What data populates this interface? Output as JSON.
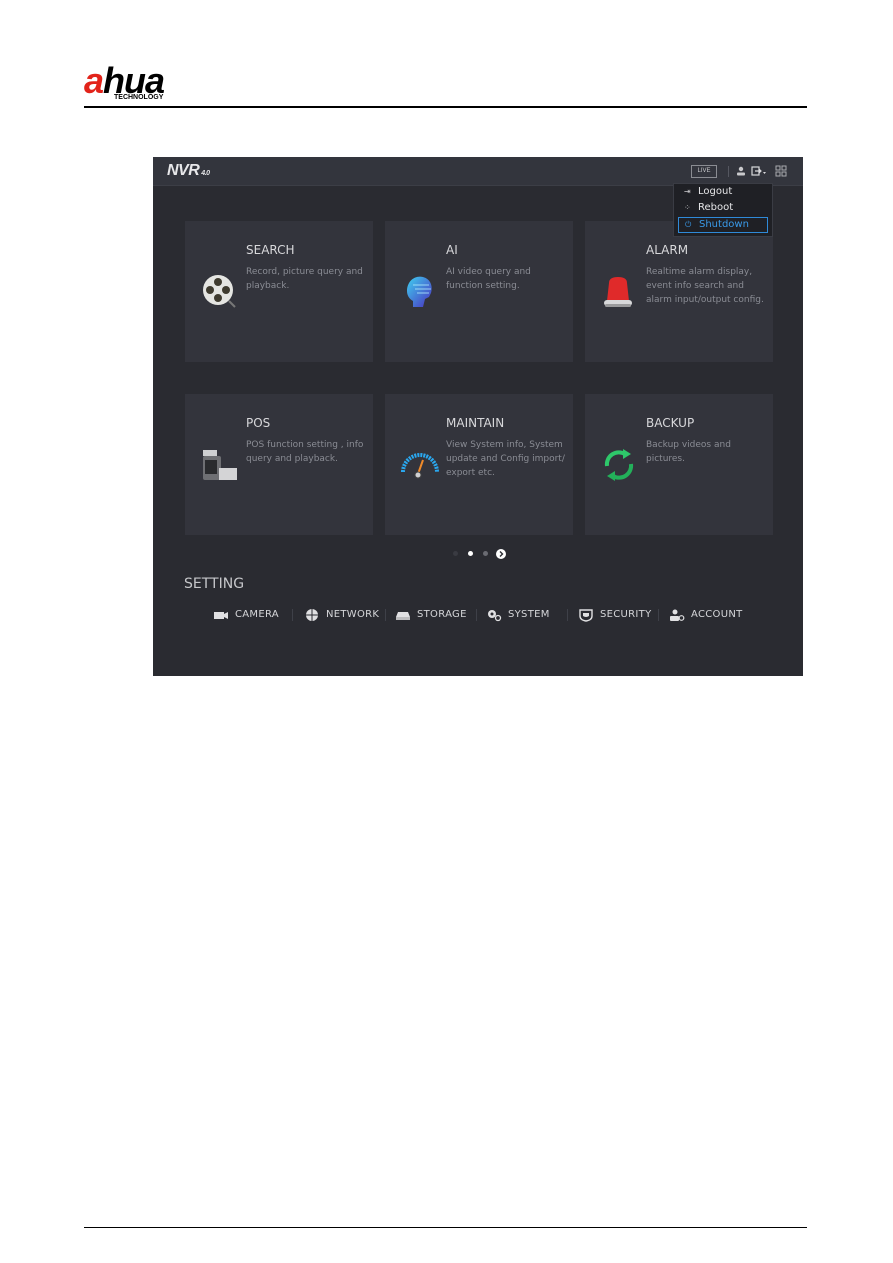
{
  "document": {
    "brand": {
      "name_red": "a",
      "name_black": "hua",
      "tagline": "TECHNOLOGY"
    }
  },
  "app": {
    "title": "NVR",
    "version": "4.0",
    "live_label": "LIVE",
    "icons": {
      "user": "user-icon",
      "logout_menu": "logout-menu-icon",
      "grid": "grid-icon"
    }
  },
  "power_menu": {
    "items": [
      {
        "label": "Logout",
        "icon": "logout-icon",
        "glyph": "⇥",
        "active": false
      },
      {
        "label": "Reboot",
        "icon": "reboot-icon",
        "glyph": "⁘",
        "active": false
      },
      {
        "label": "Shutdown",
        "icon": "power-icon",
        "glyph": "⏻",
        "active": true
      }
    ]
  },
  "modules": [
    {
      "title": "SEARCH",
      "desc": "Record, picture query and playback.",
      "icon": "film-reel-icon"
    },
    {
      "title": "AI",
      "desc": "AI video query and function setting.",
      "icon": "ai-head-icon"
    },
    {
      "title": "ALARM",
      "desc": "Realtime alarm display, event info search and alarm input/output config.",
      "icon": "alarm-light-icon"
    },
    {
      "title": "POS",
      "desc": "POS function setting , info query and playback.",
      "icon": "pos-terminal-icon"
    },
    {
      "title": "MAINTAIN",
      "desc": "View System info, System update and Config import/ export etc.",
      "icon": "gauge-icon"
    },
    {
      "title": "BACKUP",
      "desc": "Backup videos and pictures.",
      "icon": "sync-arrows-icon"
    }
  ],
  "pagination": {
    "pages": 3,
    "current": 2
  },
  "setting": {
    "title": "SETTING",
    "items": [
      {
        "label": "CAMERA",
        "icon": "camera-icon"
      },
      {
        "label": "NETWORK",
        "icon": "network-globe-icon"
      },
      {
        "label": "STORAGE",
        "icon": "storage-icon"
      },
      {
        "label": "SYSTEM",
        "icon": "system-gears-icon"
      },
      {
        "label": "SECURITY",
        "icon": "security-shield-icon"
      },
      {
        "label": "ACCOUNT",
        "icon": "account-icon"
      }
    ]
  }
}
